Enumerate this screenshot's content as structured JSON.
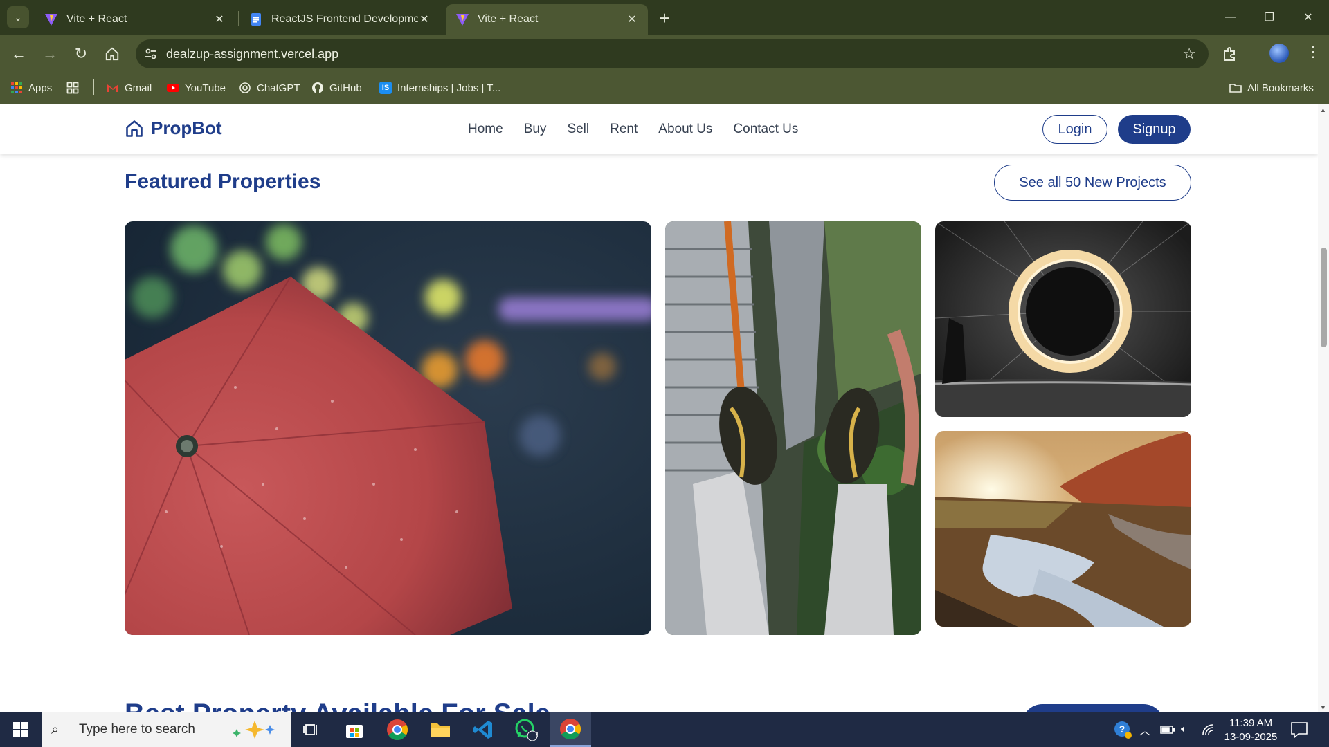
{
  "browser": {
    "tabs": [
      {
        "title": "Vite + React",
        "active": false
      },
      {
        "title": "ReactJS Frontend Development",
        "active": false
      },
      {
        "title": "Vite + React",
        "active": true
      }
    ],
    "url": "dealzup-assignment.vercel.app",
    "bookmarks": [
      {
        "label": "Apps"
      },
      {
        "label": "Gmail"
      },
      {
        "label": "YouTube"
      },
      {
        "label": "ChatGPT"
      },
      {
        "label": "GitHub"
      },
      {
        "label": "Internships | Jobs | T..."
      }
    ],
    "all_bookmarks": "All Bookmarks"
  },
  "site": {
    "brand": "PropBot",
    "nav": [
      "Home",
      "Buy",
      "Sell",
      "Rent",
      "About Us",
      "Contact Us"
    ],
    "login": "Login",
    "signup": "Signup",
    "section_title": "Featured Properties",
    "see_all": "See all 50 New Projects",
    "next_section_title": "Best Property Available For Sale"
  },
  "taskbar": {
    "search_placeholder": "Type here to search",
    "time": "11:39 AM",
    "date": "13-09-2025",
    "whatsapp_badge": "1"
  },
  "colors": {
    "brand": "#1f3d8a",
    "chrome_frame": "#2f3a1f",
    "chrome_toolbar": "#4c5733",
    "taskbar": "#1f2a44"
  }
}
